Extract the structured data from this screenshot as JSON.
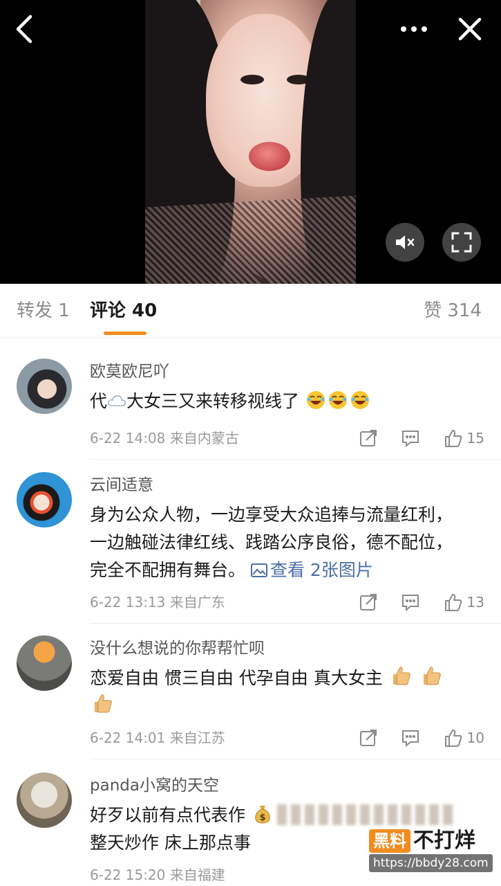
{
  "tabs": {
    "repost": "转发 1",
    "comments": "评论 40",
    "likes": "赞 314"
  },
  "comments": [
    {
      "username": "欧莫欧尼吖",
      "text_pre": "代",
      "text_post": "大女三又来转移视线了",
      "time": "6-22 14:08 来自内蒙古",
      "likes": "15",
      "icons": [
        "cloud-emoji",
        "laughing-emoji"
      ]
    },
    {
      "username": "云间适意",
      "text": "身为公众人物，一边享受大众追捧与流量红利，一边触碰法律红线、践踏公序良俗，德不配位，完全不配拥有舞台。",
      "link": "查看 2张图片",
      "time": "6-22 13:13 来自广东",
      "likes": "13"
    },
    {
      "username": "没什么想说的你帮帮忙呗",
      "text": "恋爱自由 惯三自由 代孕自由 真大女主",
      "time": "6-22 14:01 来自江苏",
      "likes": "10",
      "icons": [
        "thumbs-up-emoji"
      ]
    },
    {
      "username": "panda小窝的天空",
      "line1": "好歹以前有点代表作",
      "line2": "整天炒作 床上那点事",
      "time": "6-22 15:20 来自福建",
      "icons": [
        "money-bag-emoji"
      ]
    }
  ],
  "watermark": {
    "badge": "黑料",
    "text": "不打烊",
    "url": "https://bbdy28.com"
  },
  "colors": {
    "accent": "#f28c1f",
    "link": "#4a6ea9",
    "meta": "#9a9a9a"
  }
}
